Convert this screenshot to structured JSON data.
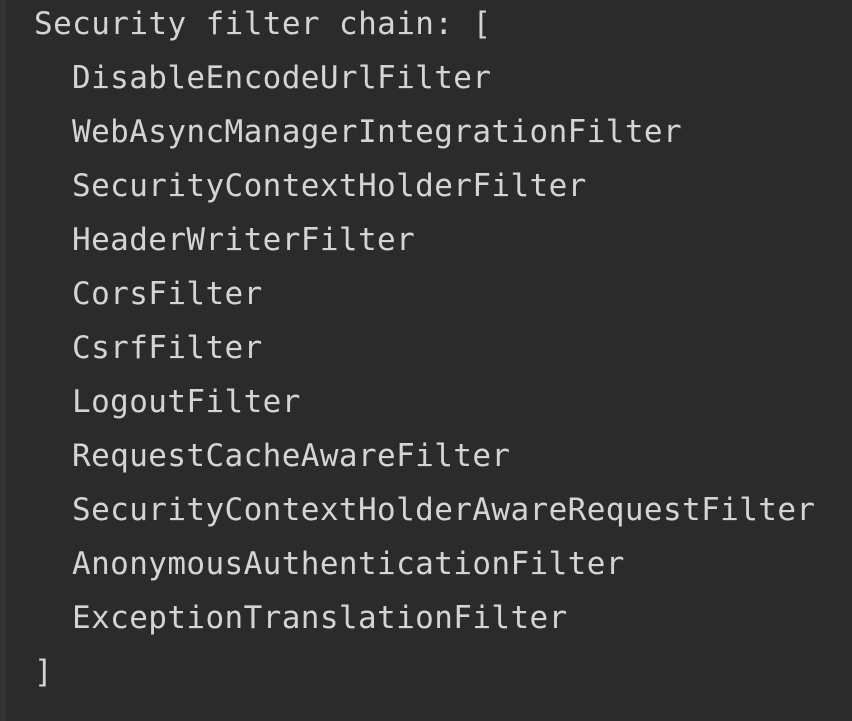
{
  "output": {
    "header": "Security filter chain: [",
    "filters": [
      "DisableEncodeUrlFilter",
      "WebAsyncManagerIntegrationFilter",
      "SecurityContextHolderFilter",
      "HeaderWriterFilter",
      "CorsFilter",
      "CsrfFilter",
      "LogoutFilter",
      "RequestCacheAwareFilter",
      "SecurityContextHolderAwareRequestFilter",
      "AnonymousAuthenticationFilter",
      "ExceptionTranslationFilter"
    ],
    "footer": "]"
  },
  "colors": {
    "background": "#2b2b2b",
    "text": "#d4d4d4"
  }
}
